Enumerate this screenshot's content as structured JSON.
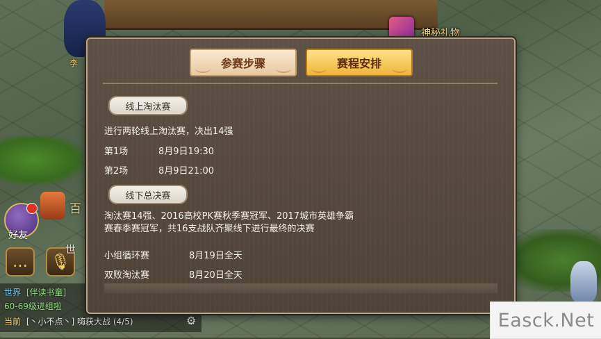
{
  "world": {
    "gift_label": "神秘礼物",
    "top_char_name": "李"
  },
  "hud": {
    "friend_label": "好友",
    "bai_label": "百",
    "shi_label": "世",
    "chat_icon": "chat-bubble-icon",
    "mic_icon": "microphone-icon"
  },
  "chat": {
    "line1_tag": "世界",
    "line1_text": "[伴读书童]",
    "line2_text": "60-69级进组啦",
    "line3_tag": "当前",
    "line3_user": "[丶小不点丶]",
    "line3_text": "嗨获大战 (4/5)"
  },
  "panel": {
    "tabs": [
      {
        "label": "参赛步骤",
        "selected": false
      },
      {
        "label": "赛程安排",
        "selected": true
      }
    ],
    "online": {
      "title": "线上淘汰赛",
      "description": "进行两轮线上淘汰赛，决出14强",
      "matches": [
        {
          "name": "第1场",
          "time": "8月9日19:30"
        },
        {
          "name": "第2场",
          "time": "8月9日21:00"
        }
      ]
    },
    "offline": {
      "title": "线下总决赛",
      "description_line1": "淘汰赛14强、2016高校PK赛秋季赛冠军、2017城市英雄争霸",
      "description_line2": "赛春季赛冠军，共16支战队齐聚线下进行最终的决赛",
      "matches": [
        {
          "name": "小组循环赛",
          "time": "8月19日全天"
        },
        {
          "name": "双败淘汰赛",
          "time": "8月20日全天"
        }
      ]
    }
  },
  "watermark": "Easck.Net",
  "colors": {
    "tab_selected": "#f0b43a",
    "tab_unselected": "#e7c9a4",
    "panel_bg": "#54493d",
    "text": "#f2efe8"
  }
}
